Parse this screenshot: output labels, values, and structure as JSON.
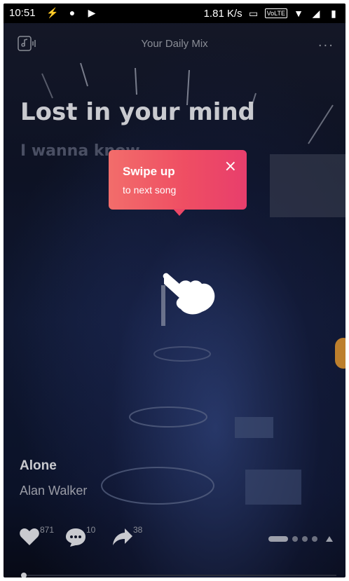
{
  "status_bar": {
    "time": "10:51",
    "speed": "1.81 K/s",
    "volte": "VoLTE"
  },
  "header": {
    "title": "Your Daily Mix",
    "more": "···"
  },
  "lyrics": {
    "line1": "Lost in your mind",
    "line2": "I wanna know"
  },
  "tooltip": {
    "title": "Swipe up",
    "subtitle": "to next song",
    "close": "×",
    "color": "#ef4e63"
  },
  "song": {
    "title": "Alone",
    "artist": "Alan Walker"
  },
  "actions": {
    "likes": "871",
    "comments": "10",
    "shares": "38"
  }
}
